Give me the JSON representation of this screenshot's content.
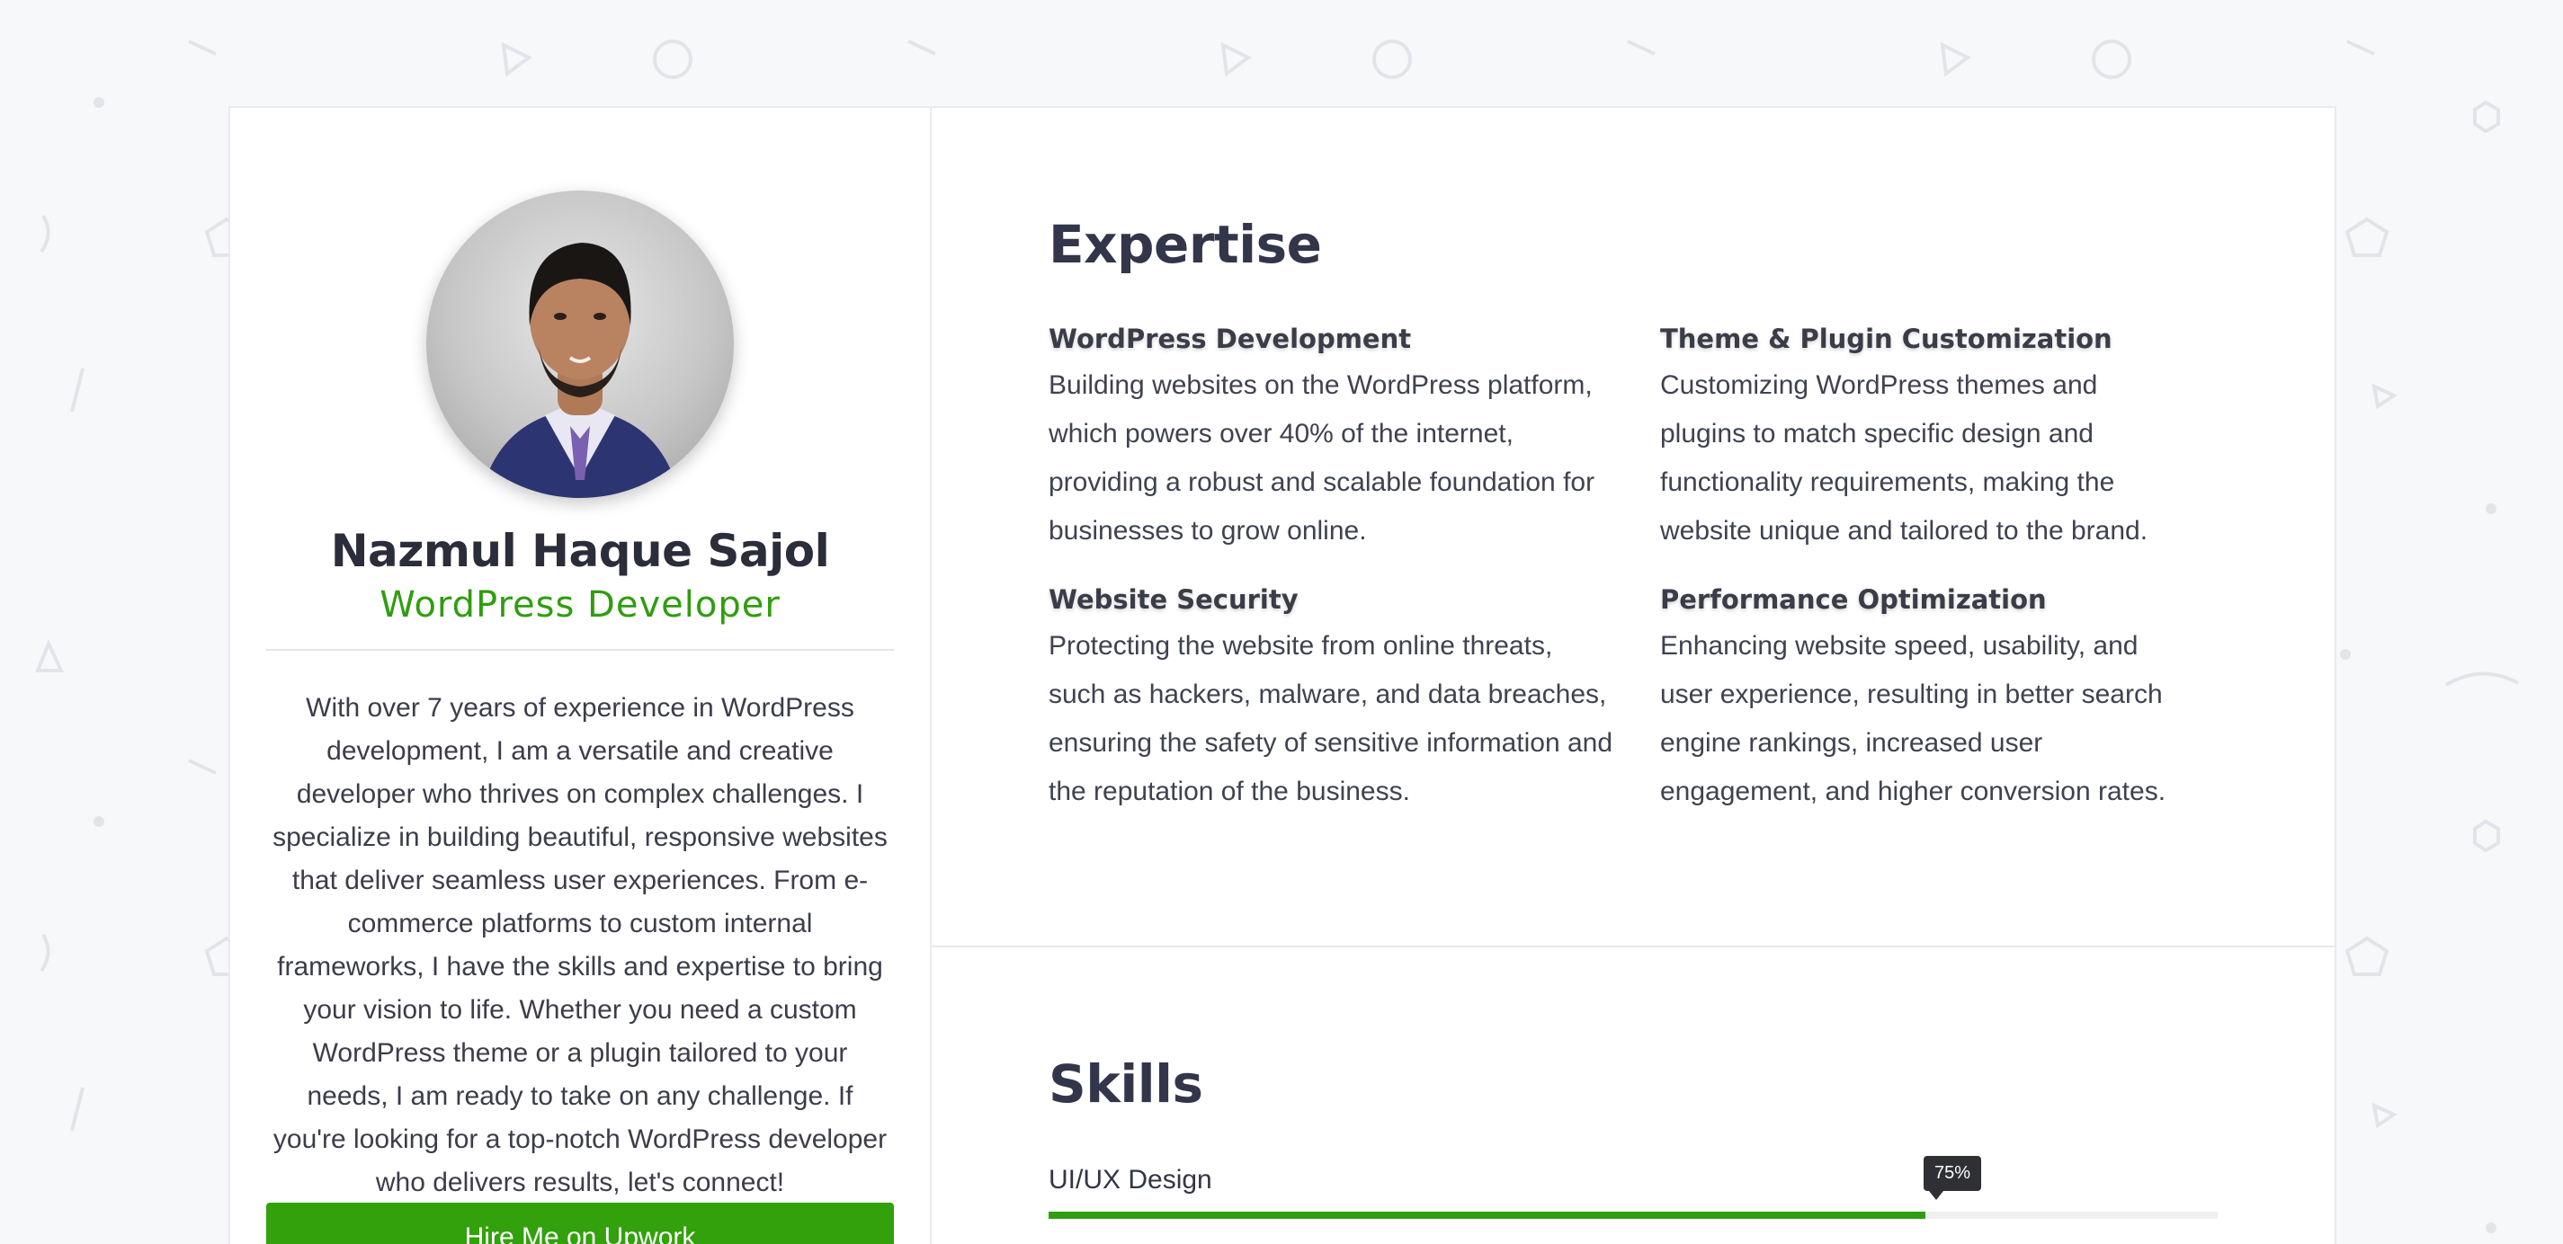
{
  "profile": {
    "name": "Nazmul Haque Sajol",
    "role": "WordPress Developer",
    "bio": "With over 7 years of experience in WordPress development, I am a versatile and creative developer who thrives on complex challenges. I specialize in building beautiful, responsive websites that deliver seamless user experiences. From e-commerce platforms to custom internal frameworks, I have the skills and expertise to bring your vision to life. Whether you need a custom WordPress theme or a plugin tailored to your needs, I am ready to take on any challenge. If you're looking for a top-notch WordPress developer who delivers results, let's connect!",
    "hire_button": "Hire Me on Upwork"
  },
  "expertise": {
    "title": "Expertise",
    "items": [
      {
        "title": "WordPress Development",
        "text": "Building websites on the WordPress platform, which powers over 40% of the internet, providing a robust and scalable foundation for businesses to grow online."
      },
      {
        "title": "Theme & Plugin Customization",
        "text": "Customizing WordPress themes and plugins to match specific design and functionality requirements, making the website unique and tailored to the brand."
      },
      {
        "title": "Website Security",
        "text": "Protecting the website from online threats, such as hackers, malware, and data breaches, ensuring the safety of sensitive information and the reputation of the business."
      },
      {
        "title": "Performance Optimization",
        "text": "Enhancing website speed, usability, and user experience, resulting in better search engine rankings, increased user engagement, and higher conversion rates."
      }
    ]
  },
  "skills": {
    "title": "Skills",
    "items": [
      {
        "label": "UI/UX Design",
        "percent_label": "75%",
        "value": 75
      }
    ]
  },
  "colors": {
    "accent": "#2f9d0f",
    "button": "#32a10c",
    "heading": "#33364a",
    "background": "#f7f8fa"
  }
}
